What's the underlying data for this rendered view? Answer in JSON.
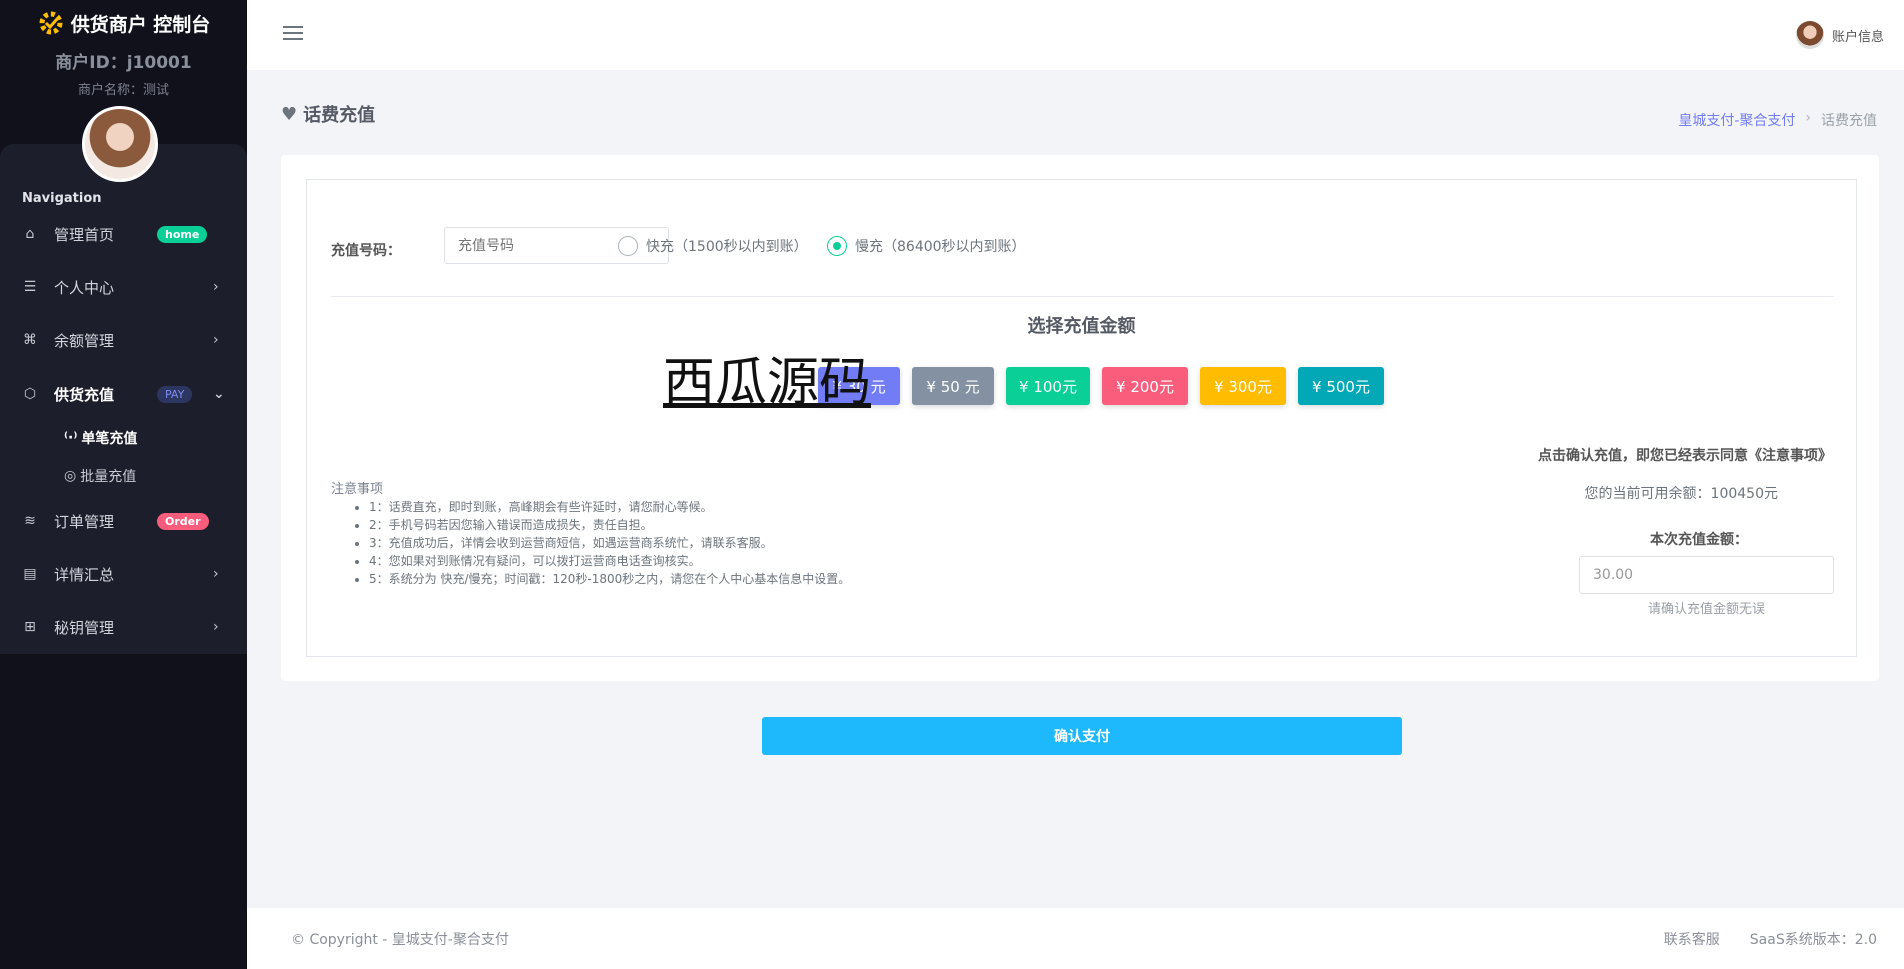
{
  "sidebar": {
    "brand": "供货商户 控制台",
    "merchant_id": "商户ID：j10001",
    "merchant_name": "商户名称：测试",
    "nav_title": "Navigation",
    "items": [
      {
        "label": "管理首页",
        "badge": "home"
      },
      {
        "label": "个人中心"
      },
      {
        "label": "余额管理"
      },
      {
        "label": "供货充值",
        "badge": "PAY"
      },
      {
        "label": "订单管理",
        "badge": "Order"
      },
      {
        "label": "详情汇总"
      },
      {
        "label": "秘钥管理"
      }
    ],
    "sub_items": [
      {
        "label": "单笔充值"
      },
      {
        "label": "批量充值"
      }
    ]
  },
  "topbar": {
    "account": "账户信息"
  },
  "page": {
    "title": "话费充值",
    "breadcrumb": [
      "皇城支付-聚合支付",
      "话费充值"
    ]
  },
  "form": {
    "phone_label": "充值号码：",
    "phone_placeholder": "充值号码",
    "radio_fast": "快充（1500秒以内到账）",
    "radio_slow": "慢充（86400秒以内到账）",
    "select_amount_title": "选择充值金额",
    "amounts": [
      "¥ 30 元",
      "¥ 50 元",
      "¥ 100元",
      "¥ 200元",
      "¥ 300元",
      "¥ 500元"
    ],
    "amount_colors": [
      "#727cf5",
      "#8391a2",
      "#0acf97",
      "#fa5c7c",
      "#ffbc00",
      "#02a8b5"
    ],
    "watermark": "西瓜源码",
    "notes_title": "注意事项",
    "notes": [
      "1：话费直充，即时到账，高峰期会有些许延时，请您耐心等候。",
      "2：手机号码若因您输入错误而造成损失，责任自担。",
      "3：充值成功后，详情会收到运营商短信，如遇运营商系统忙，请联系客服。",
      "4：您如果对到账情况有疑问，可以拨打运营商电话查询核实。",
      "5：系统分为 快充/慢充；时间戳：120秒-1800秒之内，请您在个人中心基本信息中设置。"
    ],
    "agree_text": "点击确认充值，即您已经表示同意《注意事项》",
    "balance_text": "您的当前可用余额：100450元",
    "amount_label": "本次充值金额：",
    "amount_value": "30.00",
    "amount_hint": "请确认充值金额无误",
    "confirm": "确认支付"
  },
  "footer": {
    "copyright": "© Copyright - 皇城支付-聚合支付",
    "contact": "联系客服",
    "version": "SaaS系统版本：2.0"
  }
}
